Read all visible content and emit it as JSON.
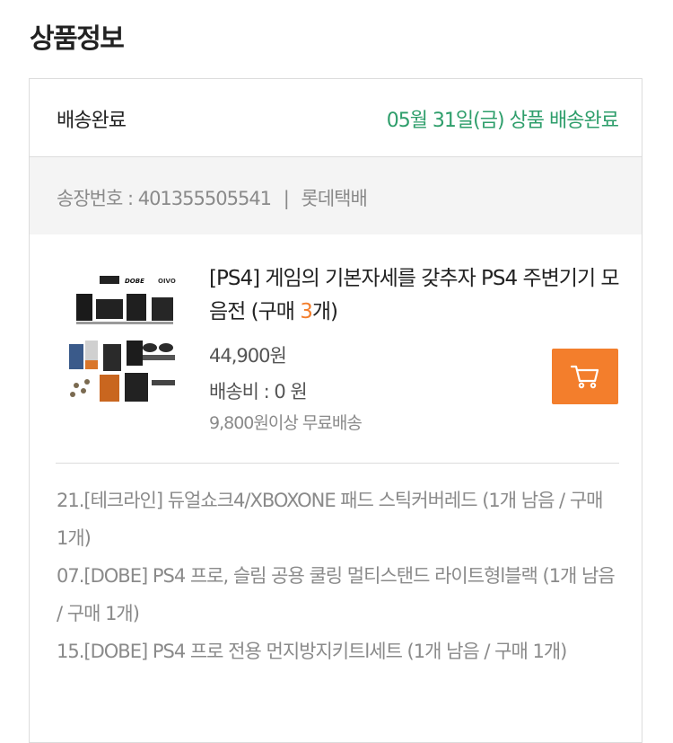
{
  "section": {
    "title": "상품정보"
  },
  "order": {
    "status_label": "배송완료",
    "status_date": "05월 31일(금) 상품 배송완료",
    "tracking_label": "송장번호 : 401355505541",
    "tracking_separator": "|",
    "courier": "롯데택배"
  },
  "product": {
    "title_prefix": "[PS4] 게임의 기본자세를 갖추자 PS4 주변기기 모음전 (구매 ",
    "quantity": "3",
    "title_suffix": "개)",
    "price": "44,900원",
    "shipping_fee": "배송비 : 0 원",
    "free_shipping": "9,800원이상 무료배송",
    "thumbnail_brands": [
      "DOBE",
      "OIVO"
    ],
    "cart_icon": "cart-icon"
  },
  "options": [
    "21.[테크라인] 듀얼쇼크4/XBOXONE 패드 스틱커버레드 (1개 남음 / 구매 1개)",
    "07.[DOBE] PS4 프로, 슬림 공용 쿨링 멀티스탠드 라이트형l블랙 (1개 남음 / 구매 1개)",
    "15.[DOBE] PS4 프로 전용 먼지방지키트l세트 (1개 남음 / 구매 1개)"
  ],
  "colors": {
    "accent_green": "#2e9e6b",
    "accent_orange": "#f37e2c",
    "muted_text": "#8a8a8a"
  }
}
